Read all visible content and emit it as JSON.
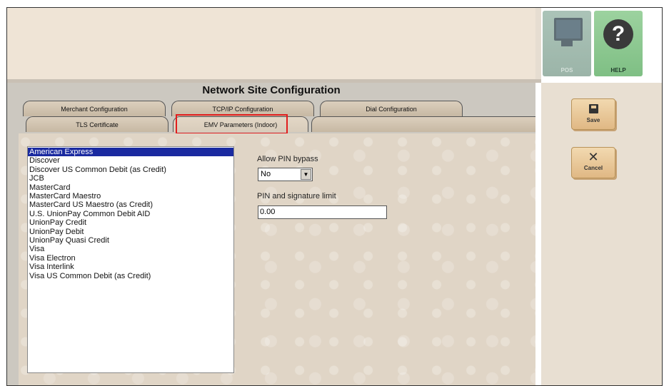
{
  "header": {
    "pos_label": "POS",
    "help_label": "HELP"
  },
  "config_title": "Network Site Configuration",
  "tabs": {
    "merchant": "Merchant Configuration",
    "tcpip": "TCP/IP Configuration",
    "dial": "Dial Configuration",
    "tls": "TLS Certificate",
    "emv": "EMV Parameters (Indoor)"
  },
  "card_list": [
    "American Express",
    "Discover",
    "Discover US Common Debit (as Credit)",
    "JCB",
    "MasterCard",
    "MasterCard Maestro",
    "MasterCard US Maestro (as Credit)",
    "U.S. UnionPay Common Debit AID",
    "UnionPay Credit",
    "UnionPay Debit",
    "UnionPay Quasi Credit",
    "Visa",
    "Visa Electron",
    "Visa Interlink",
    "Visa US Common Debit (as Credit)"
  ],
  "selected_card": "American Express",
  "fields": {
    "pin_bypass_label": "Allow PIN bypass",
    "pin_bypass_value": "No",
    "sig_limit_label": "PIN and signature limit",
    "sig_limit_value": "0.00"
  },
  "side": {
    "save_label": "Save",
    "cancel_label": "Cancel"
  },
  "colors": {
    "highlight": "#e11d1d",
    "selection": "#1a2aa0",
    "help_button": "#8fc993"
  }
}
